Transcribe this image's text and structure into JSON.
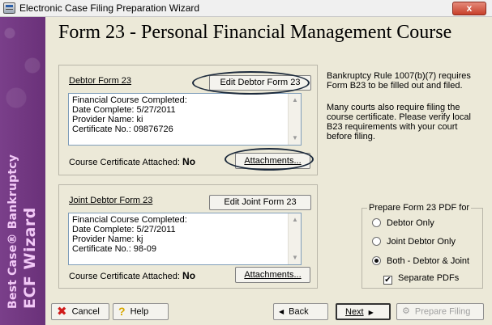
{
  "window": {
    "title": "Electronic Case Filing Preparation Wizard",
    "close_label": "x"
  },
  "sidebar": {
    "line1": "Best Case® Bankruptcy",
    "line2": "ECF Wizard"
  },
  "header": {
    "title": "Form 23 - Personal Financial Management Course"
  },
  "debtor": {
    "label": "Debtor Form 23",
    "edit_button": "Edit Debtor Form 23",
    "details": [
      "Financial Course Completed:",
      "Date Complete: 5/27/2011",
      "Provider Name: ki",
      "Certificate  No.: 09876726"
    ],
    "certificate_label": "Course Certificate Attached:",
    "certificate_value": "No",
    "attachments_button": "Attachments..."
  },
  "joint_debtor": {
    "label": "Joint Debtor Form 23",
    "edit_button": "Edit Joint Form 23",
    "details": [
      "Financial Course Completed:",
      "Date Complete: 5/27/2011",
      "Provider Name: kj",
      "Certificate  No.: 98-09"
    ],
    "certificate_label": "Course Certificate Attached:",
    "certificate_value": "No",
    "attachments_button": "Attachments..."
  },
  "info": {
    "paragraph1": "Bankruptcy Rule 1007(b)(7) requires Form B23 to be filled out and filed.",
    "paragraph2": "Many courts also require filing the course certificate. Please verify local B23 requirements with your court before filing."
  },
  "prepare_pdf": {
    "legend": "Prepare Form 23 PDF for",
    "options": [
      "Debtor Only",
      "Joint Debtor Only",
      "Both - Debtor & Joint"
    ],
    "selected": "Both - Debtor & Joint",
    "separate_pdfs_label": "Separate PDFs",
    "separate_pdfs_checked": true
  },
  "footer": {
    "cancel": "Cancel",
    "help": "Help",
    "back": "Back",
    "next": "Next",
    "prepare_filing": "Prepare Filing"
  },
  "colors": {
    "sidebar": "#6a3179",
    "sidebar_text": "#f2c9f7",
    "close_button": "#c7402b"
  },
  "icons": {
    "app": "app-icon",
    "cancel": "x-icon",
    "help": "question-icon",
    "back": "triangle-left-icon",
    "next": "triangle-right-icon",
    "prepare": "gears-icon"
  }
}
